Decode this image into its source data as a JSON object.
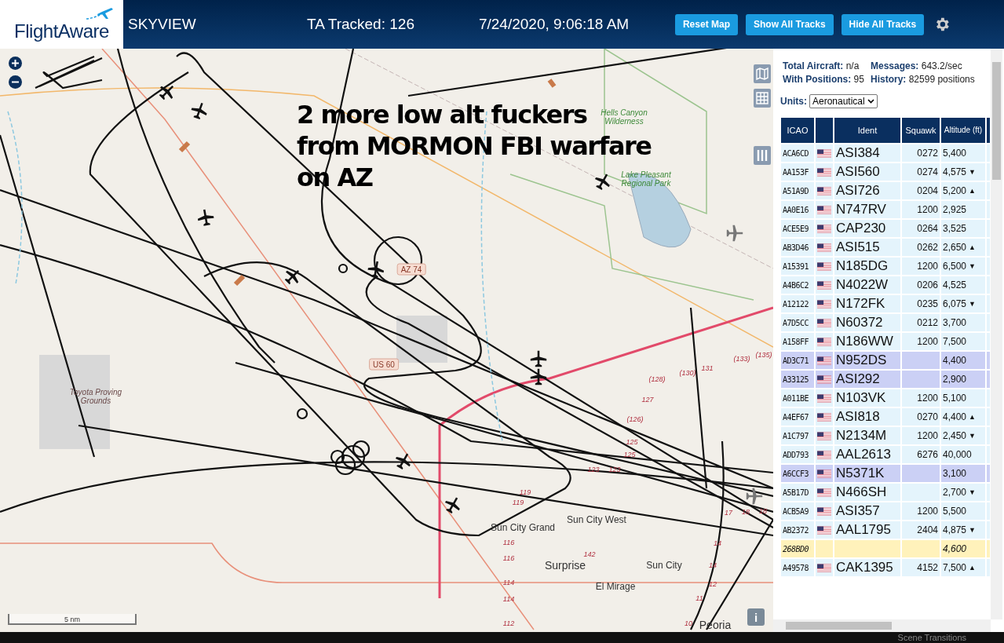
{
  "header": {
    "logo": "FlightAware",
    "title": "SKYVIEW",
    "tracked": "TA Tracked: 126",
    "datetime": "7/24/2020, 9:06:18 AM",
    "buttons": [
      "Reset Map",
      "Show All Tracks",
      "Hide All Tracks"
    ]
  },
  "map": {
    "annotation": [
      "2 more low alt fuckers",
      "from MORMON FBI warfare",
      "on AZ"
    ],
    "places": [
      {
        "label": "Hells Canyon Wilderness",
        "kind": "park"
      },
      {
        "label": "Lake Pleasant Regional Park",
        "kind": "park"
      },
      {
        "label": "Toyota Proving Grounds",
        "kind": "area"
      },
      {
        "label": "Sun City Grand",
        "kind": "town"
      },
      {
        "label": "Sun City West",
        "kind": "town"
      },
      {
        "label": "Surprise",
        "kind": "city"
      },
      {
        "label": "Sun City",
        "kind": "town"
      },
      {
        "label": "El Mirage",
        "kind": "town"
      },
      {
        "label": "Peoria",
        "kind": "city"
      }
    ],
    "shields": [
      "US 60",
      "AZ 74"
    ],
    "route_markers": [
      "(128)",
      "(130)",
      "131",
      "(133)",
      "(135)",
      "127",
      "(126)",
      "125",
      "125",
      "123",
      "123",
      "119",
      "119",
      "116",
      "116",
      "114",
      "114",
      "112",
      "142",
      "17",
      "18",
      "18",
      "14",
      "14",
      "12",
      "11",
      "10"
    ],
    "scale": "5 nm",
    "info": "i"
  },
  "stats": [
    {
      "label": "Total Aircraft:",
      "value": "n/a"
    },
    {
      "label": "Messages:",
      "value": "643.2/sec"
    },
    {
      "label": "With Positions:",
      "value": "95"
    },
    {
      "label": "History:",
      "value": "82599 positions"
    }
  ],
  "units": {
    "label": "Units:",
    "value": "Aeronautical"
  },
  "table": {
    "columns": [
      "ICAO",
      "",
      "Ident",
      "Squawk",
      "Altitude (ft)"
    ],
    "rows": [
      {
        "icao": "ACA6CD",
        "flag": true,
        "ident": "ASI384",
        "squawk": "0272",
        "altitude": "5,400",
        "trend": "",
        "kind": "normal"
      },
      {
        "icao": "AA153F",
        "flag": true,
        "ident": "ASI560",
        "squawk": "0274",
        "altitude": "4,575",
        "trend": "▼",
        "kind": "normal"
      },
      {
        "icao": "A51A9D",
        "flag": true,
        "ident": "ASI726",
        "squawk": "0204",
        "altitude": "5,200",
        "trend": "▲",
        "kind": "normal"
      },
      {
        "icao": "AA0E16",
        "flag": true,
        "ident": "N747RV",
        "squawk": "1200",
        "altitude": "2,925",
        "trend": "",
        "kind": "normal"
      },
      {
        "icao": "ACE5E9",
        "flag": true,
        "ident": "CAP230",
        "squawk": "0264",
        "altitude": "3,525",
        "trend": "",
        "kind": "normal"
      },
      {
        "icao": "AB3D46",
        "flag": true,
        "ident": "ASI515",
        "squawk": "0262",
        "altitude": "2,650",
        "trend": "▲",
        "kind": "normal"
      },
      {
        "icao": "A15391",
        "flag": true,
        "ident": "N185DG",
        "squawk": "1200",
        "altitude": "6,500",
        "trend": "▼",
        "kind": "normal"
      },
      {
        "icao": "A4B6C2",
        "flag": true,
        "ident": "N4022W",
        "squawk": "0206",
        "altitude": "4,525",
        "trend": "",
        "kind": "normal"
      },
      {
        "icao": "A12122",
        "flag": true,
        "ident": "N172FK",
        "squawk": "0235",
        "altitude": "6,075",
        "trend": "▼",
        "kind": "normal"
      },
      {
        "icao": "A7D5CC",
        "flag": true,
        "ident": "N60372",
        "squawk": "0212",
        "altitude": "3,700",
        "trend": "",
        "kind": "normal"
      },
      {
        "icao": "A158FF",
        "flag": true,
        "ident": "N186WW",
        "squawk": "1200",
        "altitude": "7,500",
        "trend": "",
        "kind": "normal"
      },
      {
        "icao": "AD3C71",
        "flag": true,
        "ident": "N952DS",
        "squawk": "",
        "altitude": "4,400",
        "trend": "",
        "kind": "mlat"
      },
      {
        "icao": "A33125",
        "flag": true,
        "ident": "ASI292",
        "squawk": "",
        "altitude": "2,900",
        "trend": "",
        "kind": "mlat"
      },
      {
        "icao": "A011BE",
        "flag": true,
        "ident": "N103VK",
        "squawk": "1200",
        "altitude": "5,100",
        "trend": "",
        "kind": "normal"
      },
      {
        "icao": "A4EF67",
        "flag": true,
        "ident": "ASI818",
        "squawk": "0270",
        "altitude": "4,400",
        "trend": "▲",
        "kind": "normal"
      },
      {
        "icao": "A1C797",
        "flag": true,
        "ident": "N2134M",
        "squawk": "1200",
        "altitude": "2,450",
        "trend": "▼",
        "kind": "normal"
      },
      {
        "icao": "ADD793",
        "flag": true,
        "ident": "AAL2613",
        "squawk": "6276",
        "altitude": "40,000",
        "trend": "",
        "kind": "normal"
      },
      {
        "icao": "A6CCF3",
        "flag": true,
        "ident": "N5371K",
        "squawk": "",
        "altitude": "3,100",
        "trend": "",
        "kind": "mlat"
      },
      {
        "icao": "A5B17D",
        "flag": true,
        "ident": "N466SH",
        "squawk": "",
        "altitude": "2,700",
        "trend": "▼",
        "kind": "normal"
      },
      {
        "icao": "ACB5A9",
        "flag": true,
        "ident": "ASI357",
        "squawk": "1200",
        "altitude": "5,500",
        "trend": "",
        "kind": "normal"
      },
      {
        "icao": "AB2372",
        "flag": true,
        "ident": "AAL1795",
        "squawk": "2404",
        "altitude": "4,875",
        "trend": "▼",
        "kind": "normal"
      },
      {
        "icao": "268BD0",
        "flag": false,
        "ident": "",
        "squawk": "",
        "altitude": "4,600",
        "trend": "",
        "kind": "tisb"
      },
      {
        "icao": "A49578",
        "flag": true,
        "ident": "CAK1395",
        "squawk": "4152",
        "altitude": "7,500",
        "trend": "▲",
        "kind": "normal"
      }
    ]
  },
  "taskbar": {
    "label": "Scene Transitions"
  }
}
